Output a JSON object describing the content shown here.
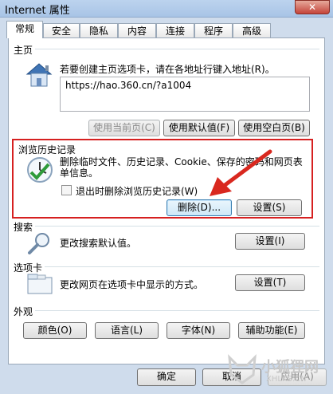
{
  "window": {
    "title": "Internet 属性",
    "close_label": "✕"
  },
  "tabs": [
    {
      "label": "常规",
      "active": true
    },
    {
      "label": "安全"
    },
    {
      "label": "隐私"
    },
    {
      "label": "内容"
    },
    {
      "label": "连接"
    },
    {
      "label": "程序"
    },
    {
      "label": "高级"
    }
  ],
  "home": {
    "section": "主页",
    "description": "若要创建主页选项卡，请在各地址行键入地址(R)。",
    "url": "https://hao.360.cn/?a1004",
    "use_current": "使用当前页(C)",
    "use_default": "使用默认值(F)",
    "use_blank": "使用空白页(B)"
  },
  "history": {
    "section": "浏览历史记录",
    "description": "删除临时文件、历史记录、Cookie、保存的密码和网页表单信息。",
    "checkbox_label": "退出时删除浏览历史记录(W)",
    "delete_button": "删除(D)...",
    "settings_button": "设置(S)"
  },
  "search": {
    "section": "搜索",
    "description": "更改搜索默认值。",
    "settings_button": "设置(I)"
  },
  "tabs_section": {
    "section": "选项卡",
    "description": "更改网页在选项卡中显示的方式。",
    "settings_button": "设置(T)"
  },
  "appearance": {
    "section": "外观",
    "colors": "颜色(O)",
    "languages": "语言(L)",
    "fonts": "字体(N)",
    "accessibility": "辅助功能(E)"
  },
  "footer": {
    "ok": "确定",
    "cancel": "取消",
    "apply": "应用(A)"
  },
  "watermark": {
    "text": "小狐狸网",
    "sub": "XHLKS.CN"
  }
}
